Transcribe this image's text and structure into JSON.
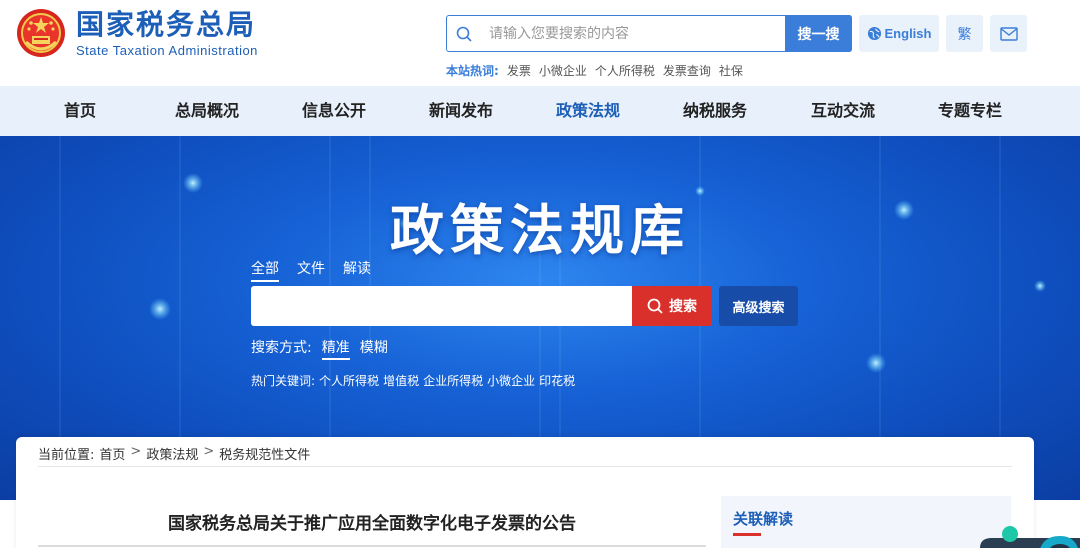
{
  "header": {
    "logo_cn": "国家税务总局",
    "logo_en": "State Taxation Administration",
    "search_placeholder": "请输入您要搜索的内容",
    "search_button": "搜一搜",
    "english_label": "English",
    "traditional_label": "繁",
    "hot_label": "本站热词:",
    "hot_words": [
      "发票",
      "小微企业",
      "个人所得税",
      "发票查询",
      "社保"
    ]
  },
  "nav": {
    "items": [
      "首页",
      "总局概况",
      "信息公开",
      "新闻发布",
      "政策法规",
      "纳税服务",
      "互动交流",
      "专题专栏"
    ],
    "active_index": 4
  },
  "banner": {
    "title": "政策法规库",
    "tabs": [
      "全部",
      "文件",
      "解读"
    ],
    "search_button": "搜索",
    "advanced_button": "高级搜索",
    "mode_label": "搜索方式:",
    "modes": [
      "精准",
      "模糊"
    ],
    "hot_label": "热门关键词:",
    "hot_keywords": [
      "个人所得税",
      "增值税",
      "企业所得税",
      "小微企业",
      "印花税"
    ]
  },
  "content": {
    "breadcrumb_label": "当前位置:",
    "breadcrumb": [
      "首页",
      "政策法规",
      "税务规范性文件"
    ],
    "article_title": "国家税务总局关于推广应用全面数字化电子发票的公告",
    "related_title": "关联解读"
  },
  "colors": {
    "brand_blue": "#1d5fb8",
    "accent_blue": "#3b7ed9",
    "nav_bg": "#e8f1fb",
    "search_red": "#d9302c"
  }
}
